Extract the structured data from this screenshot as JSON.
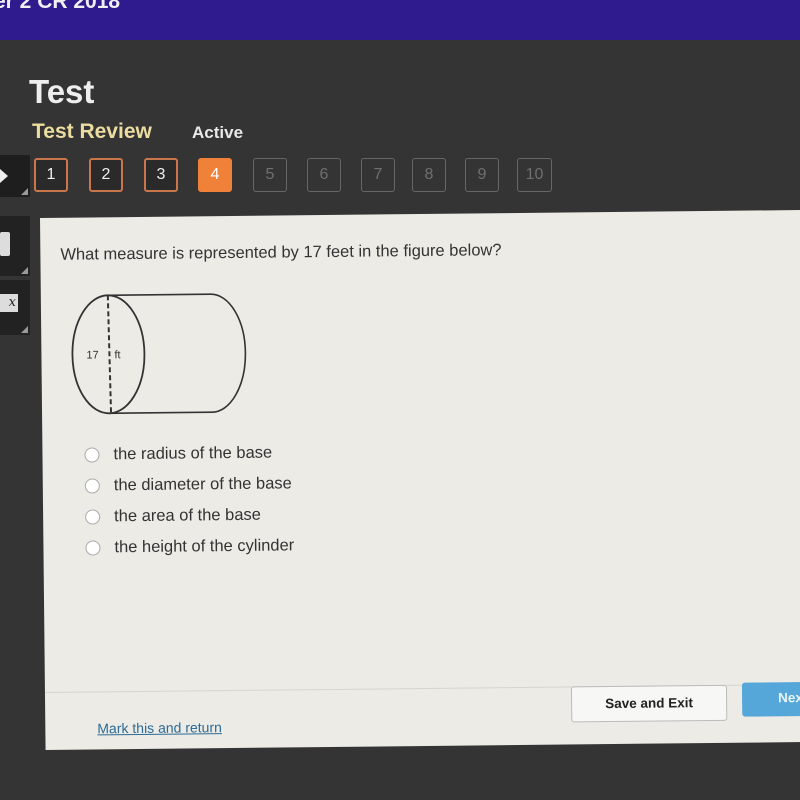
{
  "header": {
    "course_title": "er 2 CR 2018"
  },
  "page": {
    "title": "Test",
    "subtitle": "Test Review",
    "status": "Active"
  },
  "navigation": {
    "questions": [
      {
        "label": "1",
        "state": "answered"
      },
      {
        "label": "2",
        "state": "answered"
      },
      {
        "label": "3",
        "state": "answered"
      },
      {
        "label": "4",
        "state": "current"
      },
      {
        "label": "5",
        "state": "locked"
      },
      {
        "label": "6",
        "state": "locked"
      },
      {
        "label": "7",
        "state": "locked"
      },
      {
        "label": "8",
        "state": "locked"
      },
      {
        "label": "9",
        "state": "locked"
      },
      {
        "label": "10",
        "state": "locked"
      }
    ],
    "next_icon": "play-arrow-icon",
    "accent_color": "#ef8139"
  },
  "sidebar": {
    "tools": [
      {
        "name": "expand-icon"
      },
      {
        "name": "calculator-icon"
      },
      {
        "name": "square-root-icon",
        "glyph": "x"
      }
    ]
  },
  "question": {
    "prompt": "What measure is represented by 17 feet in the figure below?",
    "figure": {
      "shape": "cylinder",
      "label": "17 ft",
      "label_value": "17",
      "label_unit": "ft"
    },
    "options": [
      {
        "label": "the radius of the base",
        "selected": false
      },
      {
        "label": "the diameter of the base",
        "selected": false
      },
      {
        "label": "the area of the base",
        "selected": false
      },
      {
        "label": "the height of the cylinder",
        "selected": false
      }
    ]
  },
  "footer": {
    "mark_link": "Mark this and return",
    "save_button": "Save and Exit",
    "next_button": "Next",
    "next_visible": "Nex",
    "link_color": "#2d6b96",
    "next_color": "#55a7d9"
  }
}
